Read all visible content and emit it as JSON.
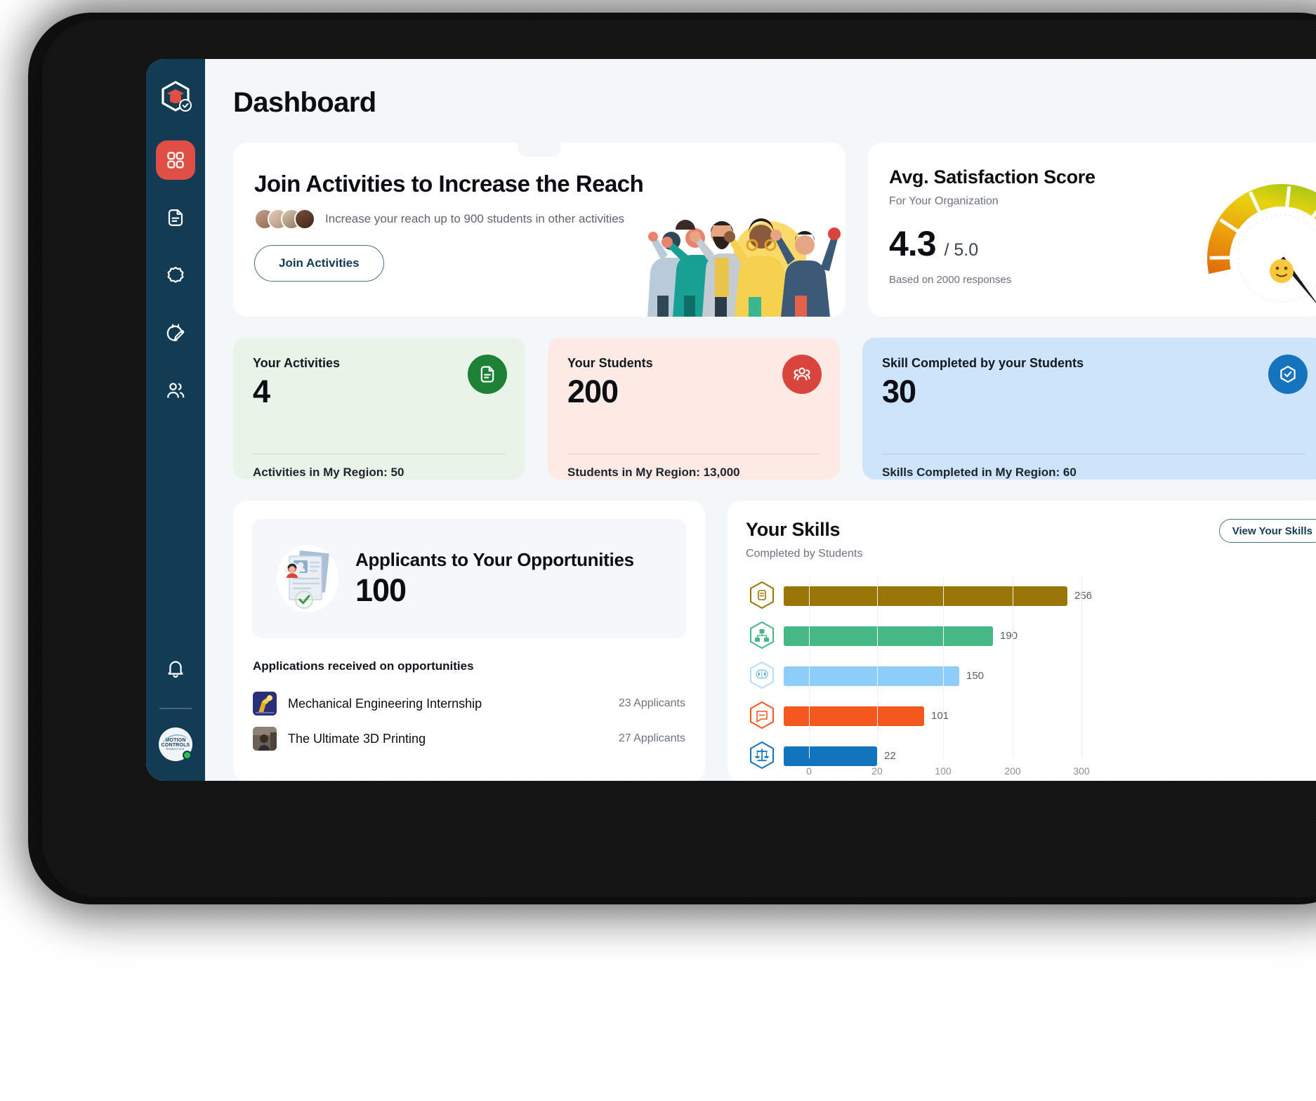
{
  "app": {
    "page_title": "Dashboard",
    "brand_logo": "graduation-cap-badge-logo"
  },
  "sidebar": {
    "items": [
      {
        "name": "dashboard",
        "icon": "grid-icon",
        "active": true
      },
      {
        "name": "documents",
        "icon": "document-icon",
        "active": false
      },
      {
        "name": "badges",
        "icon": "badge-seal-icon",
        "active": false
      },
      {
        "name": "schedule",
        "icon": "calendar-edit-icon",
        "active": false
      },
      {
        "name": "people",
        "icon": "users-icon",
        "active": false
      }
    ],
    "bell": {
      "icon": "bell-icon"
    },
    "account": {
      "logo_line1": "MOTION",
      "logo_line2": "CONTROLS",
      "logo_line3": "ROBOTICS",
      "status": "online"
    }
  },
  "hero": {
    "title": "Join Activities to Increase the Reach",
    "subtitle": "Increase your reach up to 900 students in other activities",
    "button_label": "Join Activities",
    "avatars": 4,
    "illustration": "celebrating-people-illustration"
  },
  "satisfaction": {
    "title": "Avg. Satisfaction Score",
    "subtitle": "For Your Organization",
    "score": "4.3",
    "out_of": "/ 5.0",
    "footnote": "Based on 2000 responses",
    "gauge_icon": "neutral-face-emoji",
    "gauge_value": 4.3,
    "gauge_max": 5.0
  },
  "stats": [
    {
      "label": "Your Activities",
      "value": "4",
      "footer_label": "Activities in My Region:",
      "footer_value": "50",
      "theme": "green",
      "icon": "document-icon"
    },
    {
      "label": "Your Students",
      "value": "200",
      "footer_label": "Students in My Region:",
      "footer_value": "13,000",
      "theme": "pink",
      "icon": "users-group-icon"
    },
    {
      "label": "Skill Completed by your Students",
      "value": "30",
      "footer_label": "Skills Completed in My Region:",
      "footer_value": "60",
      "theme": "blue",
      "icon": "hexagon-check-icon"
    }
  ],
  "applicants": {
    "title": "Applicants to Your Opportunities",
    "count": "100",
    "illustration": "resume-document-check-illustration",
    "list_heading": "Applications received on opportunities",
    "rows": [
      {
        "name": "Mechanical Engineering Internship",
        "count": "23 Applicants",
        "thumb": "robot-arm-thumb"
      },
      {
        "name": "The Ultimate 3D Printing",
        "count": "27 Applicants",
        "thumb": "workshop-photo-thumb"
      }
    ]
  },
  "skills": {
    "title": "Your Skills",
    "subtitle": "Completed by Students",
    "button_label": "View Your Skills",
    "chart_data": {
      "type": "bar",
      "orientation": "horizontal",
      "title": "Your Skills",
      "subtitle": "Completed by Students",
      "xlabel": "",
      "ylabel": "",
      "grid": true,
      "legend": "none",
      "xticks": [
        0,
        20,
        100,
        200,
        300
      ],
      "xtick_labels": [
        "0",
        "20",
        "100",
        "200",
        "300"
      ],
      "categories": [
        "note-taking-skill",
        "organization-skill",
        "critical-thinking-skill",
        "communication-skill",
        "ethics-skill"
      ],
      "category_icons": [
        "note-icon",
        "org-chart-icon",
        "brain-icon",
        "chat-bubble-icon",
        "scales-icon"
      ],
      "values": [
        256,
        190,
        150,
        101,
        22
      ],
      "value_labels": [
        "256",
        "190",
        "150",
        "101",
        "22"
      ],
      "colors": [
        "#9a7508",
        "#45b885",
        "#8ecdf7",
        "#f4581f",
        "#1274bd"
      ]
    }
  },
  "colors": {
    "sidebar_bg": "#123B54",
    "accent_red": "#E04F45",
    "page_bg": "#f4f7fa",
    "card_green": "#e8f4e7",
    "card_pink": "#fdeae5",
    "card_blue": "#cde4fb"
  }
}
